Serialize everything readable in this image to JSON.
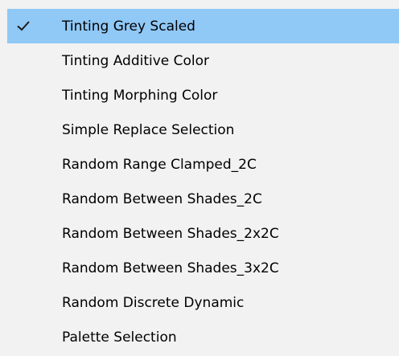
{
  "menu": {
    "items": [
      {
        "label": "Tinting Grey Scaled",
        "checked": true
      },
      {
        "label": "Tinting Additive Color",
        "checked": false
      },
      {
        "label": "Tinting Morphing Color",
        "checked": false
      },
      {
        "label": "Simple Replace Selection",
        "checked": false
      },
      {
        "label": "Random Range Clamped_2C",
        "checked": false
      },
      {
        "label": "Random Between Shades_2C",
        "checked": false
      },
      {
        "label": "Random Between Shades_2x2C",
        "checked": false
      },
      {
        "label": "Random Between Shades_3x2C",
        "checked": false
      },
      {
        "label": "Random Discrete Dynamic",
        "checked": false
      },
      {
        "label": "Palette Selection",
        "checked": false
      }
    ],
    "highlight_color": "#90c8f6",
    "background_color": "#f2f2f2",
    "check_icon": "checkmark-icon"
  }
}
